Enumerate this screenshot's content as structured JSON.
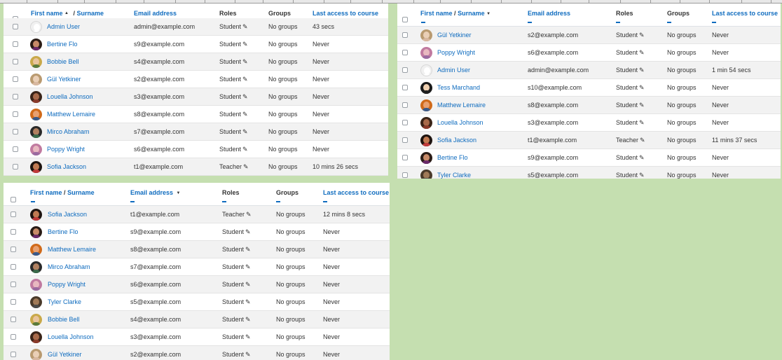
{
  "columns": {
    "first_name": "First name",
    "surname": "Surname",
    "slash": "/",
    "email": "Email address",
    "roles": "Roles",
    "groups": "Groups",
    "last_access": "Last access to course"
  },
  "icons": {
    "sort_up": "▲",
    "sort_down": "▼",
    "pencil": "✎"
  },
  "avatar_styles": {
    "blank": {
      "blank": true
    },
    "bertine": {
      "hair": "#2a1c16",
      "face": "#c78a68",
      "body": "#6a2a6a"
    },
    "bobbie": {
      "hair": "#c9a94a",
      "face": "#e9c49c",
      "body": "#5a7a3a"
    },
    "gul": {
      "hair": "#b99a70",
      "face": "#eacfb6",
      "body": "#d8b8a0"
    },
    "louella": {
      "hair": "#3a2418",
      "face": "#a86a4a",
      "body": "#8a3a2a"
    },
    "matthew": {
      "hair": "#d06a1a",
      "face": "#e8a070",
      "body": "#3a5a8a"
    },
    "mirco": {
      "hair": "#2a2a2a",
      "face": "#b08060",
      "body": "#3a6a4a"
    },
    "poppy": {
      "hair": "#c07aa0",
      "face": "#e8b8c0",
      "body": "#9a6aa0"
    },
    "sofia": {
      "hair": "#1e1410",
      "face": "#c07a52",
      "body": "#c03a3a"
    },
    "tess": {
      "hair": "#1a1a1a",
      "face": "#f0d0b0",
      "body": "#222222"
    },
    "tyler": {
      "hair": "#4a3a2a",
      "face": "#a07a58",
      "body": "#4a4a4a"
    }
  },
  "tables": [
    {
      "id": "table-sorted-firstname",
      "sort_indicator": "▲",
      "rows": [
        {
          "name": "Admin User",
          "email": "admin@example.com",
          "role": "Student",
          "groups": "No groups",
          "access": "43 secs",
          "avatar": "blank"
        },
        {
          "name": "Bertine Flo",
          "email": "s9@example.com",
          "role": "Student",
          "groups": "No groups",
          "access": "Never",
          "avatar": "bertine"
        },
        {
          "name": "Bobbie Bell",
          "email": "s4@example.com",
          "role": "Student",
          "groups": "No groups",
          "access": "Never",
          "avatar": "bobbie"
        },
        {
          "name": "Gül Yetkiner",
          "email": "s2@example.com",
          "role": "Student",
          "groups": "No groups",
          "access": "Never",
          "avatar": "gul"
        },
        {
          "name": "Louella Johnson",
          "email": "s3@example.com",
          "role": "Student",
          "groups": "No groups",
          "access": "Never",
          "avatar": "louella"
        },
        {
          "name": "Matthew Lemaire",
          "email": "s8@example.com",
          "role": "Student",
          "groups": "No groups",
          "access": "Never",
          "avatar": "matthew"
        },
        {
          "name": "Mirco Abraham",
          "email": "s7@example.com",
          "role": "Student",
          "groups": "No groups",
          "access": "Never",
          "avatar": "mirco"
        },
        {
          "name": "Poppy Wright",
          "email": "s6@example.com",
          "role": "Student",
          "groups": "No groups",
          "access": "Never",
          "avatar": "poppy"
        },
        {
          "name": "Sofia Jackson",
          "email": "t1@example.com",
          "role": "Teacher",
          "groups": "No groups",
          "access": "10 mins 26 secs",
          "avatar": "sofia"
        }
      ]
    },
    {
      "id": "table-sorted-surname",
      "sort_indicator": "▼",
      "rows": [
        {
          "name": "Gül Yetkiner",
          "email": "s2@example.com",
          "role": "Student",
          "groups": "No groups",
          "access": "Never",
          "avatar": "gul"
        },
        {
          "name": "Poppy Wright",
          "email": "s6@example.com",
          "role": "Student",
          "groups": "No groups",
          "access": "Never",
          "avatar": "poppy"
        },
        {
          "name": "Admin User",
          "email": "admin@example.com",
          "role": "Student",
          "groups": "No groups",
          "access": "1 min 54 secs",
          "avatar": "blank"
        },
        {
          "name": "Tess Marchand",
          "email": "s10@example.com",
          "role": "Student",
          "groups": "No groups",
          "access": "Never",
          "avatar": "tess"
        },
        {
          "name": "Matthew Lemaire",
          "email": "s8@example.com",
          "role": "Student",
          "groups": "No groups",
          "access": "Never",
          "avatar": "matthew"
        },
        {
          "name": "Louella Johnson",
          "email": "s3@example.com",
          "role": "Student",
          "groups": "No groups",
          "access": "Never",
          "avatar": "louella"
        },
        {
          "name": "Sofia Jackson",
          "email": "t1@example.com",
          "role": "Teacher",
          "groups": "No groups",
          "access": "11 mins 37 secs",
          "avatar": "sofia"
        },
        {
          "name": "Bertine Flo",
          "email": "s9@example.com",
          "role": "Student",
          "groups": "No groups",
          "access": "Never",
          "avatar": "bertine"
        },
        {
          "name": "Tyler Clarke",
          "email": "s5@example.com",
          "role": "Student",
          "groups": "No groups",
          "access": "Never",
          "avatar": "tyler"
        }
      ]
    },
    {
      "id": "table-sorted-email",
      "sort_indicator": "▼",
      "rows": [
        {
          "name": "Sofia Jackson",
          "email": "t1@example.com",
          "role": "Teacher",
          "groups": "No groups",
          "access": "12 mins 8 secs",
          "avatar": "sofia"
        },
        {
          "name": "Bertine Flo",
          "email": "s9@example.com",
          "role": "Student",
          "groups": "No groups",
          "access": "Never",
          "avatar": "bertine"
        },
        {
          "name": "Matthew Lemaire",
          "email": "s8@example.com",
          "role": "Student",
          "groups": "No groups",
          "access": "Never",
          "avatar": "matthew"
        },
        {
          "name": "Mirco Abraham",
          "email": "s7@example.com",
          "role": "Student",
          "groups": "No groups",
          "access": "Never",
          "avatar": "mirco"
        },
        {
          "name": "Poppy Wright",
          "email": "s6@example.com",
          "role": "Student",
          "groups": "No groups",
          "access": "Never",
          "avatar": "poppy"
        },
        {
          "name": "Tyler Clarke",
          "email": "s5@example.com",
          "role": "Student",
          "groups": "No groups",
          "access": "Never",
          "avatar": "tyler"
        },
        {
          "name": "Bobbie Bell",
          "email": "s4@example.com",
          "role": "Student",
          "groups": "No groups",
          "access": "Never",
          "avatar": "bobbie"
        },
        {
          "name": "Louella Johnson",
          "email": "s3@example.com",
          "role": "Student",
          "groups": "No groups",
          "access": "Never",
          "avatar": "louella"
        },
        {
          "name": "Gül Yetkiner",
          "email": "s2@example.com",
          "role": "Student",
          "groups": "No groups",
          "access": "Never",
          "avatar": "gul"
        }
      ]
    }
  ]
}
